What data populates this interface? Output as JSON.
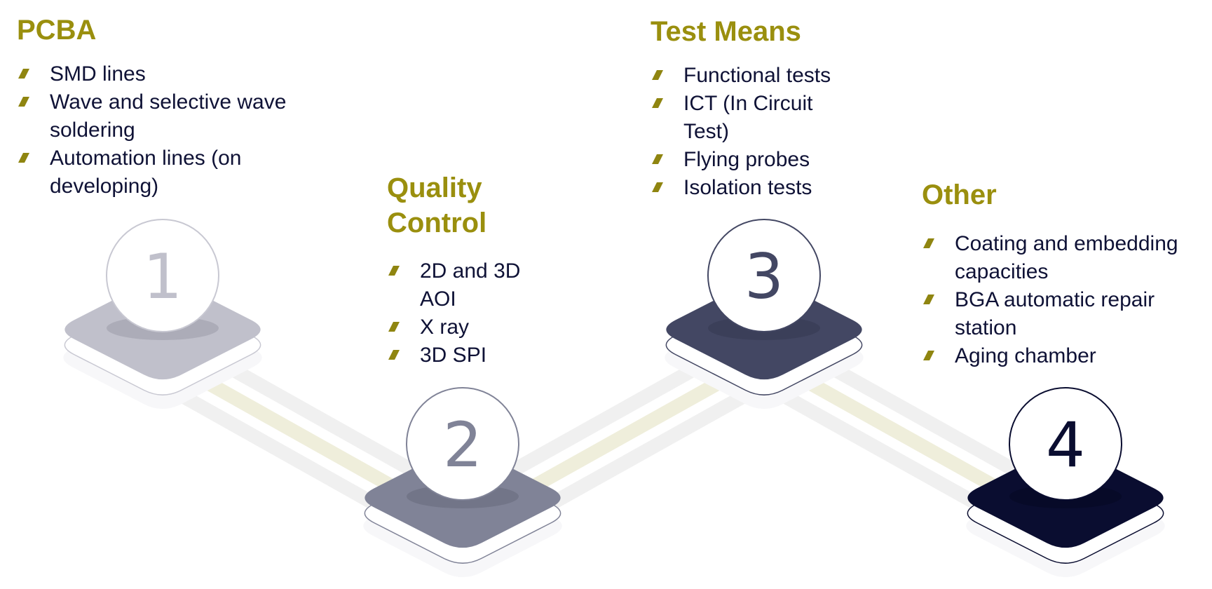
{
  "colors": {
    "title": "#9a8f0e",
    "text": "#0f1236",
    "bullet": "#8f8510",
    "track_gray": "#f0f0f0",
    "track_olive": "#efeedb"
  },
  "steps": [
    {
      "number": "1",
      "title": "PCBA",
      "items": [
        "SMD lines",
        "Wave and selective wave soldering",
        "Automation lines (on developing)"
      ],
      "platform_color": "#c0c0cb",
      "shadow_color": "#acacb8",
      "number_color": "#c0c0cb",
      "ring_color": "#c8c8d2"
    },
    {
      "number": "2",
      "title": "Quality Control",
      "items": [
        "2D and 3D AOI",
        "X ray",
        "3D SPI"
      ],
      "platform_color": "#808397",
      "shadow_color": "#727588",
      "number_color": "#808397",
      "ring_color": "#808397"
    },
    {
      "number": "3",
      "title": "Test Means",
      "items": [
        "Functional tests",
        "ICT (In Circuit Test)",
        "Flying probes",
        "Isolation tests"
      ],
      "platform_color": "#434763",
      "shadow_color": "#3b3f59",
      "number_color": "#434763",
      "ring_color": "#434763"
    },
    {
      "number": "4",
      "title": "Other",
      "items": [
        "Coating and embedding capacities",
        "BGA automatic repair station",
        "Aging chamber"
      ],
      "platform_color": "#0a0d30",
      "shadow_color": "#070a28",
      "number_color": "#0a0d30",
      "ring_color": "#0a0d30"
    }
  ]
}
